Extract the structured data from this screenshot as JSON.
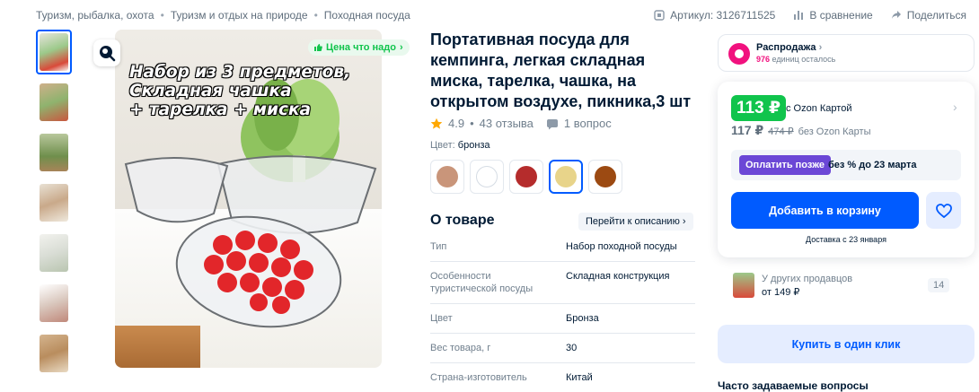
{
  "breadcrumbs": [
    "Туризм, рыбалка, охота",
    "Туризм и отдых на природе",
    "Походная посуда"
  ],
  "top_actions": {
    "article": "Артикул: 3126711525",
    "compare": "В сравнение",
    "share": "Поделиться"
  },
  "gallery": {
    "overlay_text": "Набор из 3 предметов,\nСкладная чашка\n+ тарелка + миска",
    "price_badge": "Цена что надо",
    "thumbnails": 8
  },
  "product": {
    "title": "Портативная посуда для кемпинга, легкая складная миска, тарелка, чашка, на открытом воздухе, пикника,3 шт",
    "rating": "4.9",
    "reviews": "43 отзыва",
    "questions": "1 вопрос",
    "color_label": "Цвет:",
    "color_value": "бронза",
    "swatches": [
      "#c9957a",
      "#ffffff",
      "#b52c2c",
      "#e8d48a",
      "#9c4a12"
    ],
    "selected_swatch_index": 3
  },
  "about": {
    "heading": "О товаре",
    "link": "Перейти к описанию",
    "specs": [
      {
        "k": "Тип",
        "v": "Набор походной посуды"
      },
      {
        "k": "Особенности туристической посуды",
        "v": "Складная конструкция"
      },
      {
        "k": "Цвет",
        "v": "Бронза"
      },
      {
        "k": "Вес товара, г",
        "v": "30"
      },
      {
        "k": "Страна-изготовитель",
        "v": "Китай"
      }
    ]
  },
  "sale": {
    "title": "Распродажа",
    "left_count": "976",
    "left_text": "единиц осталось"
  },
  "buy": {
    "card_price": "113 ₽",
    "card_label": "с Ozon Картой",
    "price": "117 ₽",
    "old_price": "474 ₽",
    "no_card_label": "без Ozon Карты",
    "pay_later_button": "Оплатить позже",
    "pay_later_text": "без % до 23 марта",
    "add_to_cart": "Добавить в корзину",
    "delivery": "Доставка с 23 января"
  },
  "other_sellers": {
    "title": "У других продавцов",
    "price": "от 149 ₽",
    "count": "14"
  },
  "one_click": "Купить в один клик",
  "faq": "Часто задаваемые вопросы",
  "colors": {
    "accent": "#005bff",
    "green": "#10c44c",
    "pink": "#f1117e",
    "purple": "#6b47d6"
  }
}
